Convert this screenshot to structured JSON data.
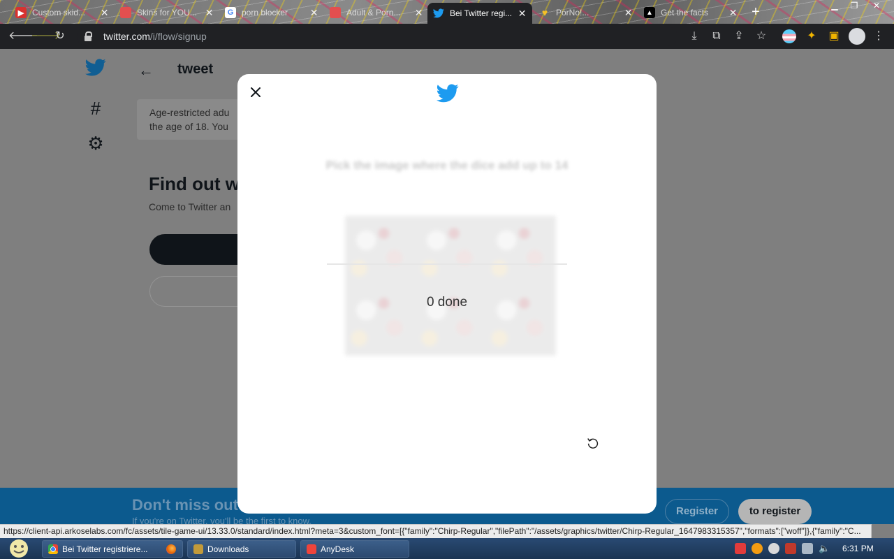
{
  "browser": {
    "tabs": [
      {
        "title": "Custom skid...",
        "favicon_color": "#d8322f",
        "active": false
      },
      {
        "title": "Skins for YOU...",
        "favicon_color": "#e34f4f",
        "active": false
      },
      {
        "title": "porn blocker",
        "favicon_color": "#4285f4",
        "active": false
      },
      {
        "title": "Adult & Porn...",
        "favicon_color": "#e34f4f",
        "active": false
      },
      {
        "title": "Bei Twitter regi...",
        "favicon_color": "#1d9bf0",
        "active": true
      },
      {
        "title": "PorNo!...",
        "favicon_color": "#f6c026",
        "active": false
      },
      {
        "title": "Get the facts",
        "favicon_color": "#000000",
        "active": false
      }
    ],
    "close_glyph": "✕",
    "new_tab_glyph": "+",
    "url_host": "twitter.com",
    "url_path": "/i/flow/signup"
  },
  "page": {
    "title": "tweet",
    "notice_line1": "Age-restricted adu",
    "notice_line2": "the age of 18. You",
    "find_title": "Find out w",
    "find_sub": "Come to Twitter an",
    "bottom_title": "Don't miss out",
    "bottom_sub": "If you're on Twitter, you'll be the first to know.",
    "register_label": "Register",
    "to_register_label": "to register"
  },
  "modal": {
    "captcha_instruction": "Pick the image where the dice add up to 14",
    "captcha_status": "0 done"
  },
  "statusbar": {
    "url": "https://client-api.arkoselabs.com/fc/assets/tile-game-ui/13.33.0/standard/index.html?meta=3&custom_font=[{\"family\":\"Chirp-Regular\",\"filePath\":\"/assets/graphics/twitter/Chirp-Regular_1647983315357\",\"formats\":[\"woff\"]},{\"family\":\"C..."
  },
  "taskbar": {
    "items": [
      {
        "label": "Bei Twitter registriere...",
        "color": "#e8453c"
      },
      {
        "label": "",
        "color": "#e66000"
      },
      {
        "label": "Downloads",
        "color": "#c29a3a"
      },
      {
        "label": "AnyDesk",
        "color": "#ef443b"
      }
    ],
    "clock": "6:31 PM"
  },
  "colors": {
    "twitter_blue": "#1d9bf0",
    "overlay_gray": "#7f7f7f",
    "chrome_dark": "#202124"
  }
}
